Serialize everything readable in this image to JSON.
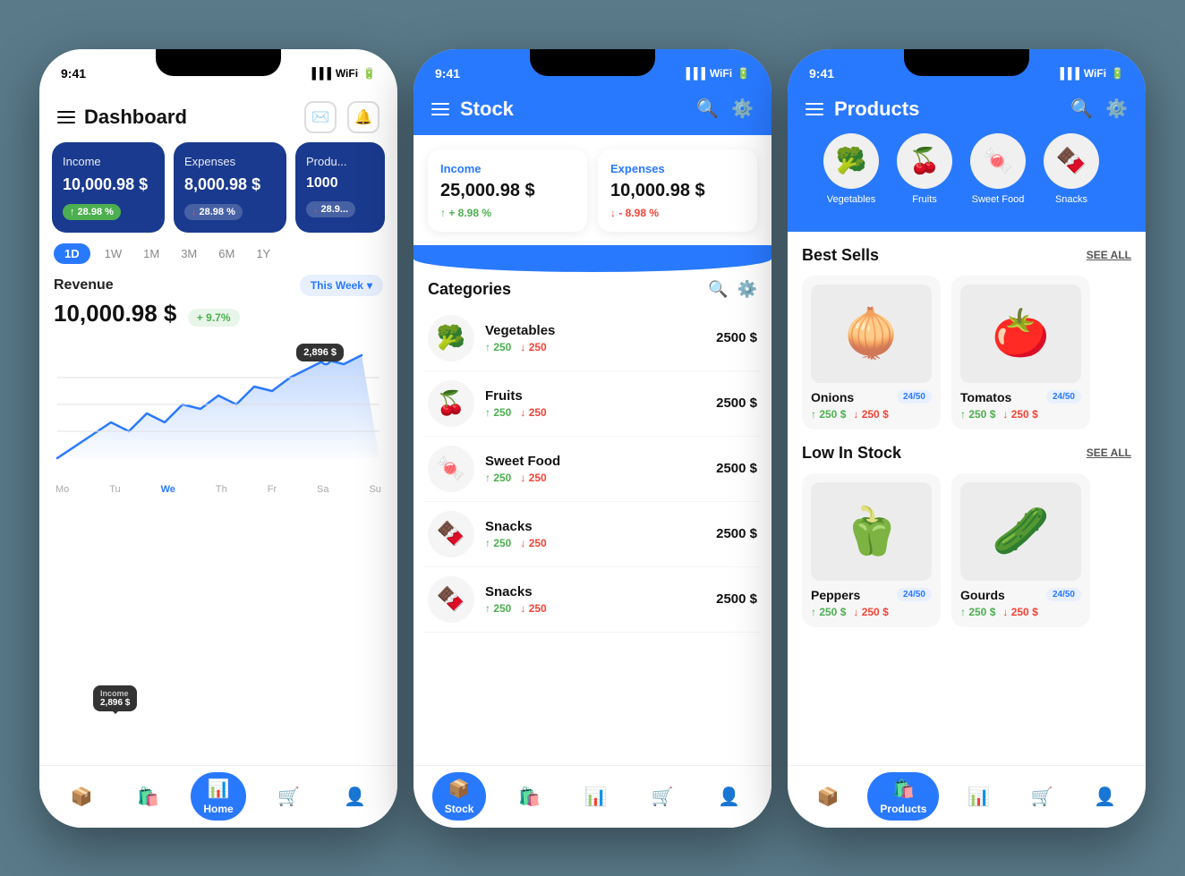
{
  "screen1": {
    "status_time": "9:41",
    "title": "Dashboard",
    "cards": [
      {
        "label": "Income",
        "value": "10,000.98 $",
        "badge": "28.98 %",
        "trend": "up"
      },
      {
        "label": "Expenses",
        "value": "8,000.98 $",
        "badge": "28.98 %",
        "trend": "down"
      },
      {
        "label": "Produ...",
        "value": "1000",
        "badge": "28.9...",
        "trend": "down"
      }
    ],
    "time_tabs": [
      "1D",
      "1W",
      "1M",
      "3M",
      "6M",
      "1Y"
    ],
    "active_tab": "1D",
    "revenue_label": "Revenue",
    "this_week": "This Week",
    "revenue_value": "10,000.98 $",
    "revenue_pct": "+ 9.7%",
    "chart_tooltip1": "2,896 $",
    "chart_tooltip2_label": "Income",
    "chart_tooltip2_value": "2,896 $",
    "days": [
      "Mo",
      "Tu",
      "We",
      "Th",
      "Fr",
      "Sa",
      "Su"
    ],
    "active_day": "We",
    "nav": [
      {
        "icon": "📦",
        "label": ""
      },
      {
        "icon": "🛍️",
        "label": ""
      },
      {
        "icon": "📊",
        "label": "Home",
        "active": true
      },
      {
        "icon": "🛒",
        "label": ""
      },
      {
        "icon": "👤",
        "label": ""
      }
    ]
  },
  "screen2": {
    "status_time": "9:41",
    "title": "Stock",
    "cards": [
      {
        "label": "Income",
        "value": "25,000.98 $",
        "pct": "+ 8.98 %",
        "trend": "up"
      },
      {
        "label": "Expenses",
        "value": "10,000.98 $",
        "pct": "- 8.98 %",
        "trend": "down"
      }
    ],
    "categories_title": "Categories",
    "categories": [
      {
        "emoji": "🥦",
        "name": "Vegetables",
        "up": "250",
        "down": "250",
        "price": "2500 $"
      },
      {
        "emoji": "🍒",
        "name": "Fruits",
        "up": "250",
        "down": "250",
        "price": "2500 $"
      },
      {
        "emoji": "🍬",
        "name": "Sweet Food",
        "up": "250",
        "down": "250",
        "price": "2500 $"
      },
      {
        "emoji": "🍫",
        "name": "Snacks",
        "up": "250",
        "down": "250",
        "price": "2500 $"
      },
      {
        "emoji": "🍫",
        "name": "Snacks",
        "up": "250",
        "down": "250",
        "price": "2500 $"
      }
    ],
    "nav": [
      {
        "icon": "📦",
        "label": "Stock",
        "active": true
      },
      {
        "icon": "🛍️",
        "label": ""
      },
      {
        "icon": "📊",
        "label": ""
      },
      {
        "icon": "🛒",
        "label": ""
      },
      {
        "icon": "👤",
        "label": ""
      }
    ]
  },
  "screen3": {
    "status_time": "9:41",
    "title": "Products",
    "categories": [
      {
        "emoji": "🥦",
        "label": "Vegetables"
      },
      {
        "emoji": "🍒",
        "label": "Fruits"
      },
      {
        "emoji": "🍬",
        "label": "Sweet Food"
      },
      {
        "emoji": "🍫",
        "label": "Snacks"
      }
    ],
    "best_sells_title": "Best Sells",
    "see_all1": "SEE ALL",
    "best_sells": [
      {
        "emoji": "🧅",
        "name": "Onions",
        "badge": "24/50",
        "up": "250 $",
        "down": "250 $"
      },
      {
        "emoji": "🍅",
        "name": "Tomatos",
        "badge": "24/50",
        "up": "250 $",
        "down": "250 $"
      }
    ],
    "low_stock_title": "Low In Stock",
    "see_all2": "SEE ALL",
    "low_stock": [
      {
        "emoji": "🫑",
        "name": "Peppers",
        "badge": "24/50",
        "up": "250 $",
        "down": "250 $"
      },
      {
        "emoji": "🥒",
        "name": "Gourds",
        "badge": "24/50",
        "up": "250 $",
        "down": "250 $"
      }
    ],
    "nav": [
      {
        "icon": "📦",
        "label": ""
      },
      {
        "icon": "🛍️",
        "label": "Products",
        "active": true
      },
      {
        "icon": "📊",
        "label": ""
      },
      {
        "icon": "🛒",
        "label": ""
      },
      {
        "icon": "👤",
        "label": ""
      }
    ]
  }
}
